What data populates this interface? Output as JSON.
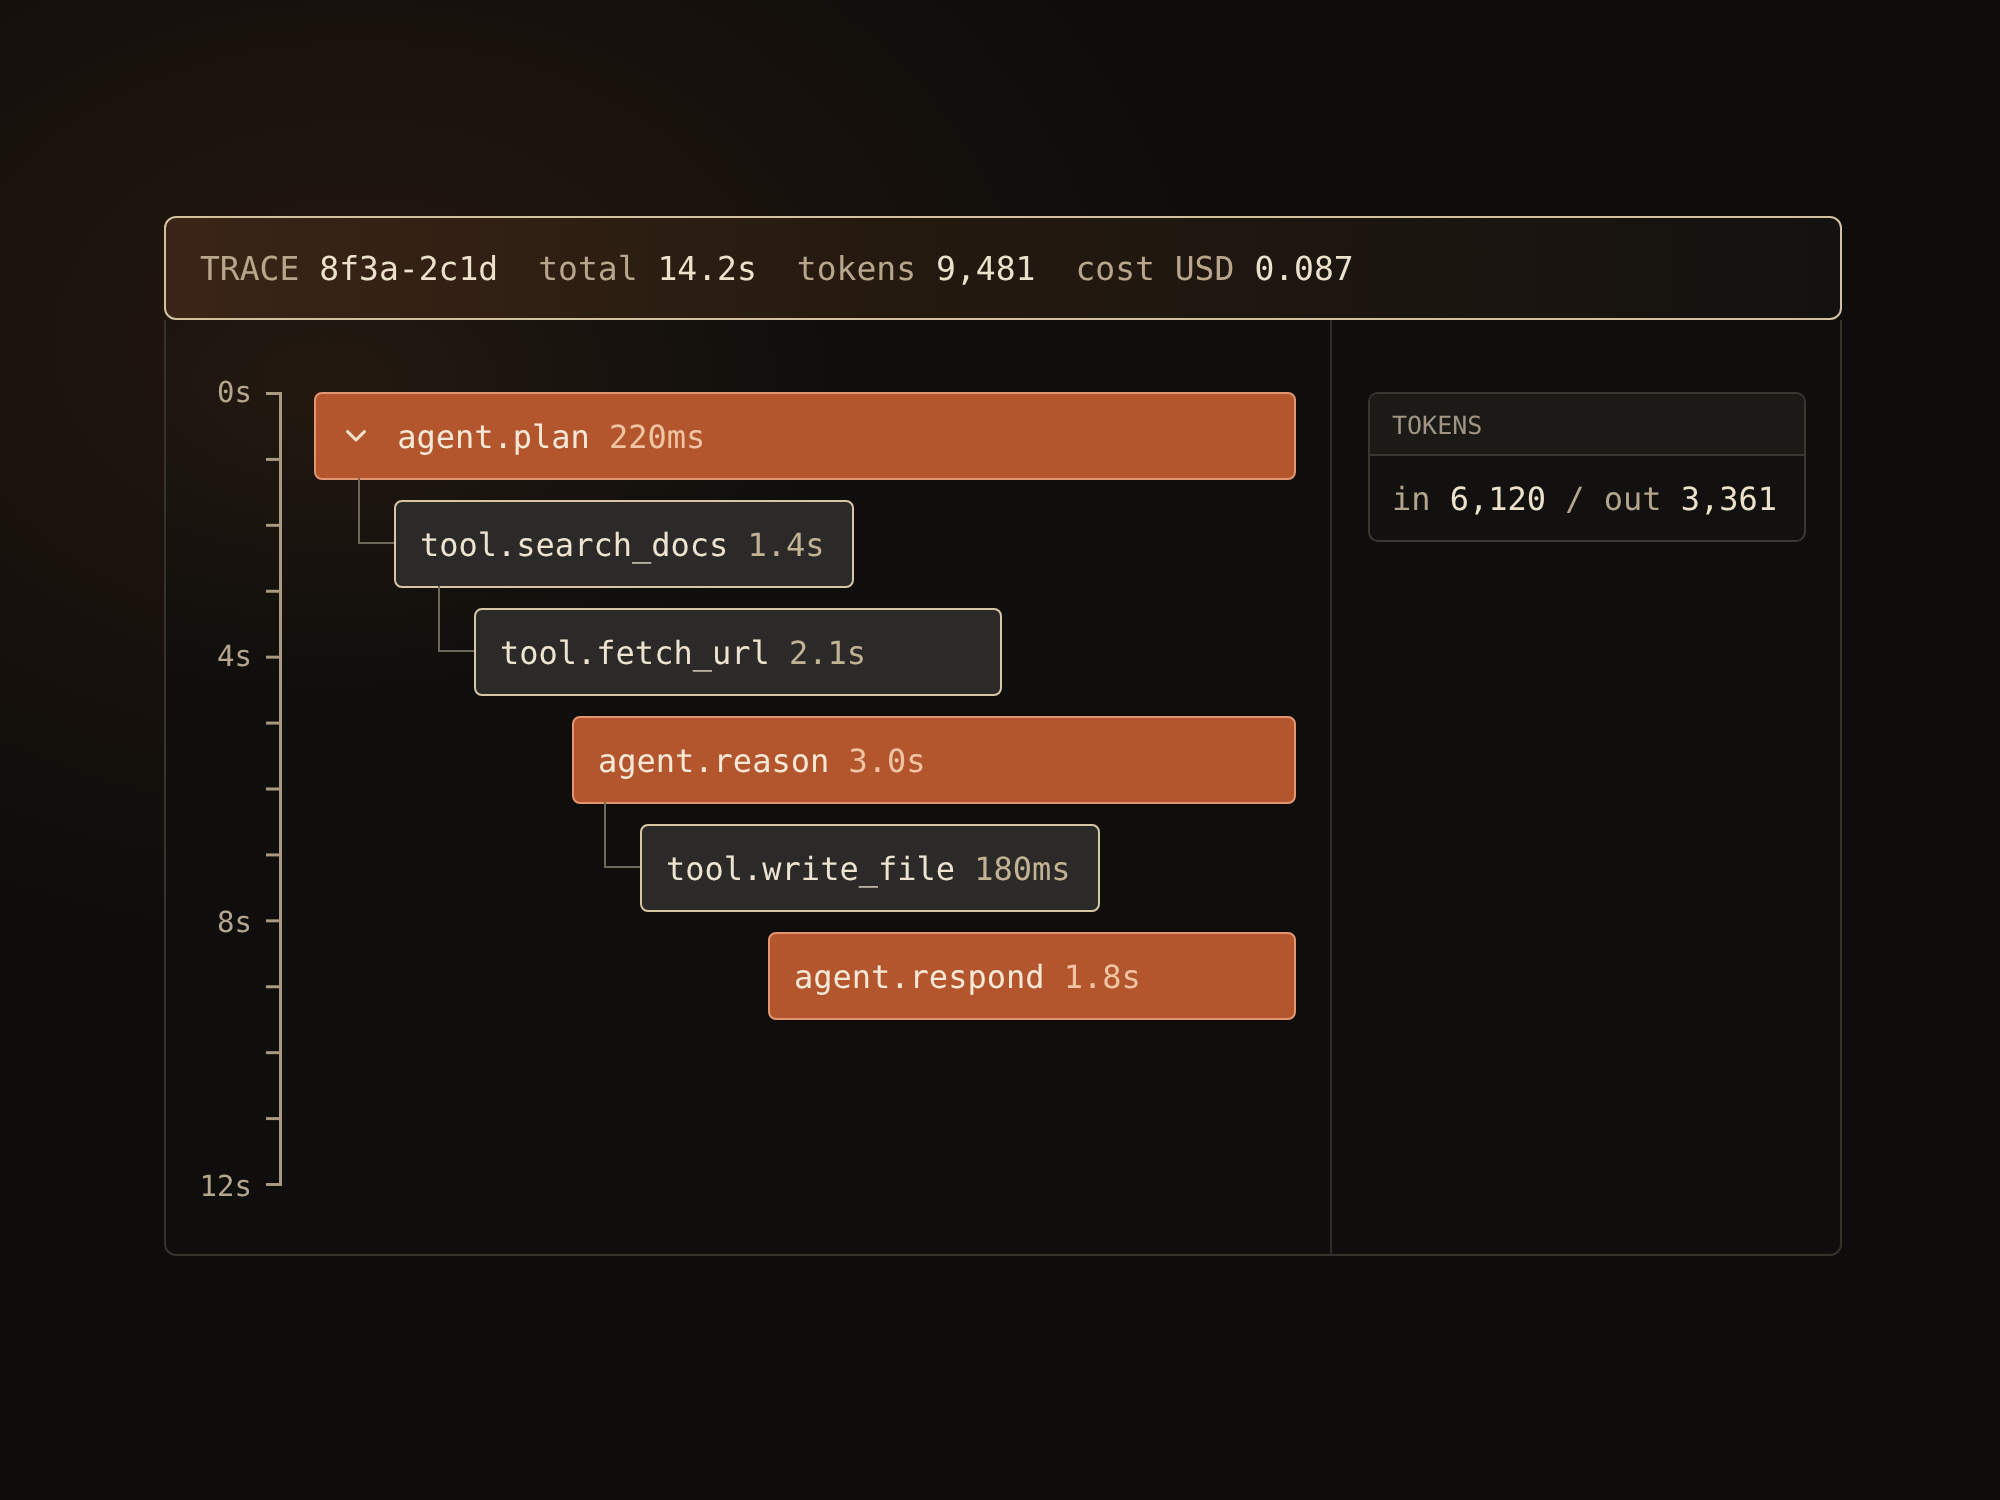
{
  "header": {
    "stats": [
      {
        "label": "TRACE",
        "value": "8f3a-2c1d"
      },
      {
        "label": "total",
        "value": "14.2s"
      },
      {
        "label": "tokens",
        "value": "9,481"
      },
      {
        "label": "cost USD",
        "value": "0.087"
      }
    ]
  },
  "axis": {
    "labels": [
      "0s",
      "4s",
      "8s",
      "12s"
    ]
  },
  "spans": [
    {
      "kind": "agent",
      "name": "agent.plan",
      "duration": "220ms",
      "expanded": true,
      "children": [
        {
          "kind": "tool",
          "name": "tool.search_docs",
          "duration": "1.4s",
          "children": [
            {
              "kind": "tool",
              "name": "tool.fetch_url",
              "duration": "2.1s"
            }
          ]
        }
      ]
    },
    {
      "kind": "agent",
      "name": "agent.reason",
      "duration": "3.0s",
      "children": [
        {
          "kind": "tool",
          "name": "tool.write_file",
          "duration": "180ms"
        }
      ]
    },
    {
      "kind": "agent",
      "name": "agent.respond",
      "duration": "1.8s"
    }
  ],
  "tokens_card": {
    "title": "TOKENS",
    "counts": [
      {
        "label": "in",
        "value": "6,120"
      },
      {
        "label": "out",
        "value": "3,361"
      }
    ],
    "separator": "/"
  }
}
